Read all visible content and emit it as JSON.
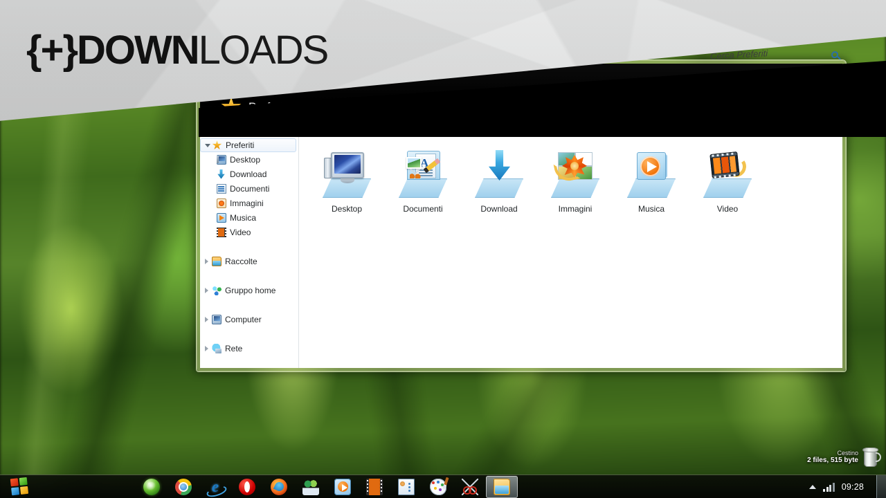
{
  "banner": {
    "logo_brace": "{+}",
    "logo_bold": "DOWN",
    "logo_light": "LOADS"
  },
  "window": {
    "title_partial": "Preferiti",
    "search": {
      "value": "Cerca Preferiti",
      "icon": "search-icon"
    },
    "toolbar": {
      "change_view_icon": "change-view-icon",
      "dropdown_icon": "chevron-down-icon",
      "preview_pane_icon": "preview-pane-icon",
      "help_icon": "help-icon",
      "help_glyph": "?"
    },
    "nav_pane": {
      "favorites": {
        "label": "Preferiti",
        "icon": "star-icon",
        "selected": true,
        "expanded": true,
        "children": [
          {
            "label": "Desktop",
            "icon": "desktop-icon"
          },
          {
            "label": "Download",
            "icon": "download-arrow-icon"
          },
          {
            "label": "Documenti",
            "icon": "documents-icon"
          },
          {
            "label": "Immagini",
            "icon": "pictures-icon"
          },
          {
            "label": "Musica",
            "icon": "music-icon"
          },
          {
            "label": "Video",
            "icon": "video-icon"
          }
        ]
      },
      "groups": [
        {
          "label": "Raccolte",
          "icon": "libraries-icon",
          "expanded": false
        },
        {
          "label": "Gruppo home",
          "icon": "homegroup-icon",
          "expanded": false
        },
        {
          "label": "Computer",
          "icon": "computer-icon",
          "expanded": false
        },
        {
          "label": "Rete",
          "icon": "network-icon",
          "expanded": false
        }
      ]
    },
    "items": [
      {
        "label": "Desktop",
        "icon": "desktop-folder-icon"
      },
      {
        "label": "Documenti",
        "icon": "documents-folder-icon"
      },
      {
        "label": "Download",
        "icon": "download-folder-icon"
      },
      {
        "label": "Immagini",
        "icon": "pictures-folder-icon"
      },
      {
        "label": "Musica",
        "icon": "music-folder-icon"
      },
      {
        "label": "Video",
        "icon": "video-folder-icon"
      }
    ]
  },
  "desktop": {
    "recycle_bin": {
      "title": "Cestino",
      "details": "2 files, 515 byte",
      "icon": "recycle-bin-icon"
    }
  },
  "taskbar": {
    "start_icon": "windows-start-icon",
    "items": [
      {
        "name": "green-orb-icon",
        "active": false
      },
      {
        "name": "chrome-icon",
        "active": false
      },
      {
        "name": "internet-explorer-icon",
        "glyph": "e",
        "active": false
      },
      {
        "name": "opera-icon",
        "active": false
      },
      {
        "name": "firefox-icon",
        "active": false
      },
      {
        "name": "messenger-people-icon",
        "active": false
      },
      {
        "name": "media-player-icon",
        "active": false
      },
      {
        "name": "movie-maker-icon",
        "active": false
      },
      {
        "name": "contacts-icon",
        "active": false
      },
      {
        "name": "paint-icon",
        "active": false
      },
      {
        "name": "snipping-tool-icon",
        "active": false
      },
      {
        "name": "file-explorer-icon",
        "active": true
      }
    ],
    "tray": {
      "chevron_icon": "show-hidden-icons-chevron",
      "network_icon": "network-signal-icon",
      "clock": "09:28",
      "show_desktop": "show-desktop-button"
    }
  },
  "colors": {
    "accent_blue": "#1e8fd0",
    "orange": "#f2760c",
    "window_glass": "#c6e5f6",
    "banner_white": "#f2f3f3",
    "banner_black": "#000000"
  }
}
